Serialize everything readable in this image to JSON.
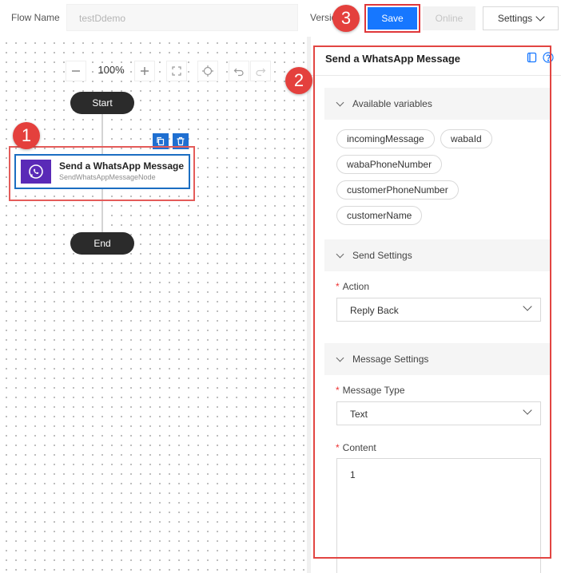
{
  "topbar": {
    "flow_name_label": "Flow Name",
    "flow_name_value": "testDdemo",
    "version_label": "Version",
    "save_label": "Save",
    "online_label": "Online",
    "settings_label": "Settings"
  },
  "annotations": [
    "1",
    "2",
    "3"
  ],
  "canvas": {
    "zoom": "100%",
    "start_label": "Start",
    "end_label": "End",
    "node": {
      "title": "Send a WhatsApp Message",
      "subtitle": "SendWhatsAppMessageNode"
    }
  },
  "panel": {
    "title": "Send a WhatsApp Message",
    "variables_section": "Available variables",
    "variables": [
      "incomingMessage",
      "wabaId",
      "wabaPhoneNumber",
      "customerPhoneNumber",
      "customerName"
    ],
    "send_settings_section": "Send Settings",
    "action_label": "Action",
    "action_value": "Reply Back",
    "message_settings_section": "Message Settings",
    "message_type_label": "Message Type",
    "message_type_value": "Text",
    "content_label": "Content",
    "content_value": "1",
    "required_mark": "*"
  },
  "colors": {
    "primary": "#1677ff",
    "node_border": "#1b6ec2",
    "node_icon_bg": "#5a2ab7",
    "annotation_red": "#e4403d",
    "pill_dark": "#2b2b2b"
  }
}
